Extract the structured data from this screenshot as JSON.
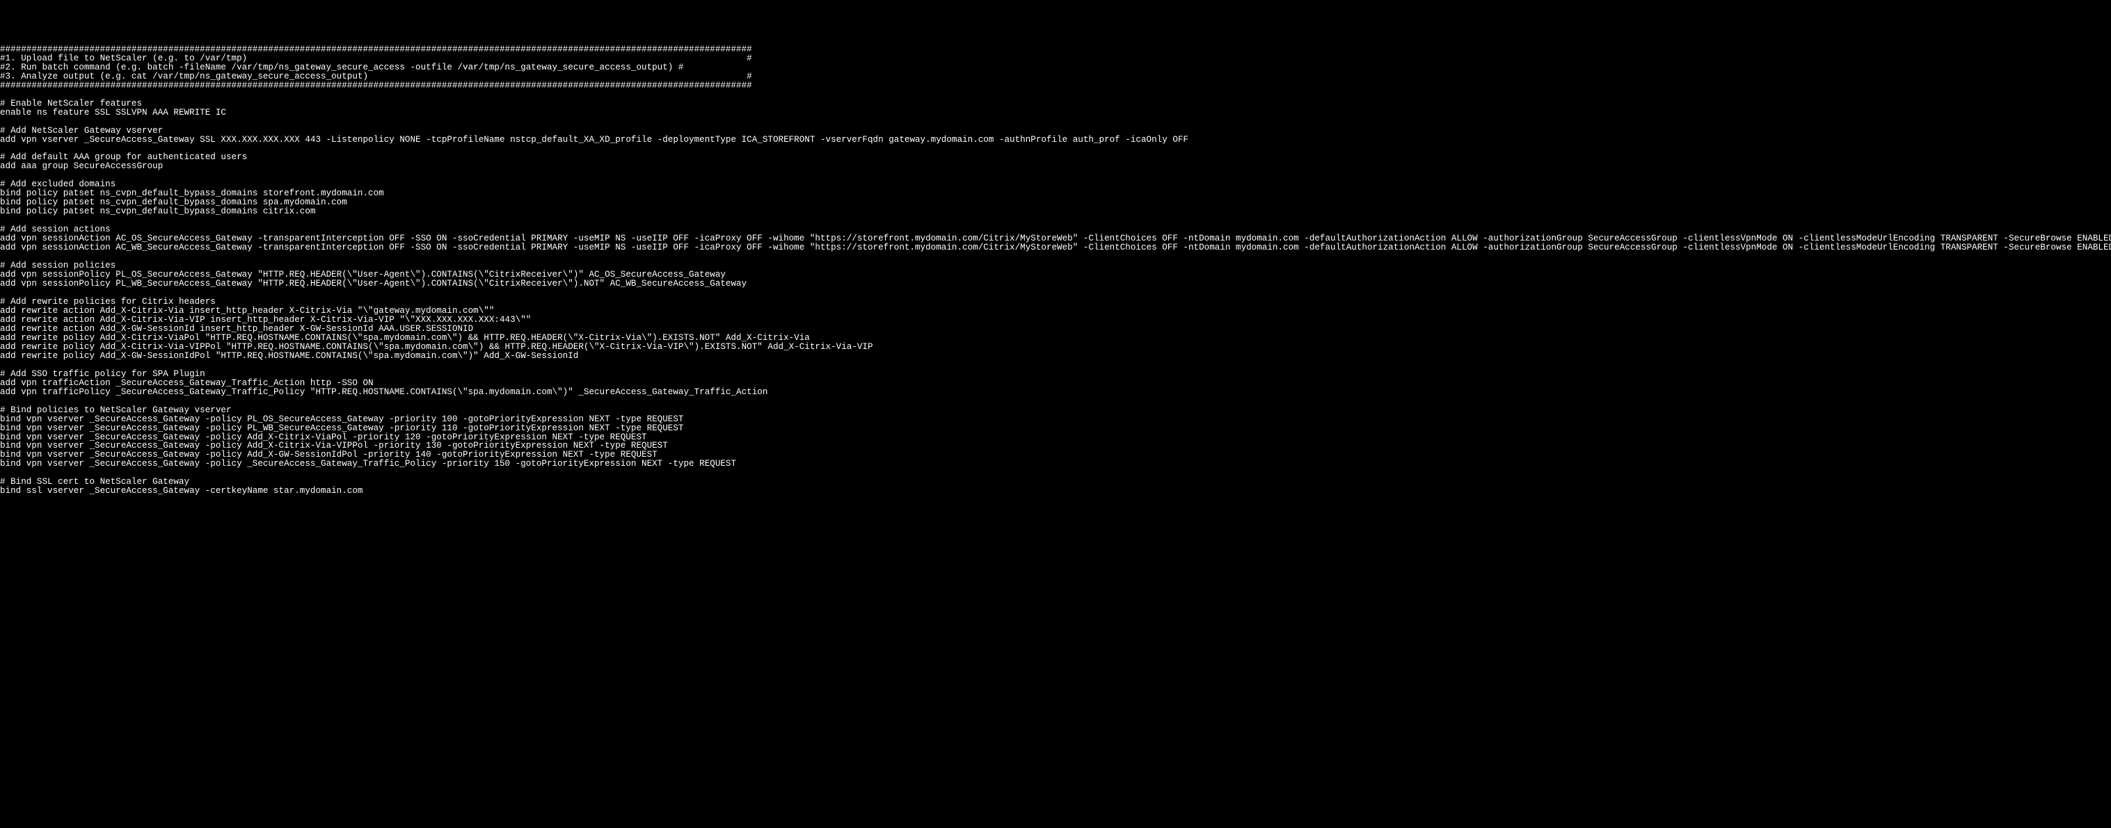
{
  "lines": [
    "###############################################################################################################################################",
    "#1. Upload file to NetScaler (e.g. to /var/tmp)                                                                                               #",
    "#2. Run batch command (e.g. batch -fileName /var/tmp/ns_gateway_secure_access -outfile /var/tmp/ns_gateway_secure_access_output) #",
    "#3. Analyze output (e.g. cat /var/tmp/ns_gateway_secure_access_output)                                                                        #",
    "###############################################################################################################################################",
    "",
    "# Enable NetScaler features",
    "enable ns feature SSL SSLVPN AAA REWRITE IC",
    "",
    "# Add NetScaler Gateway vserver",
    "add vpn vserver _SecureAccess_Gateway SSL XXX.XXX.XXX.XXX 443 -Listenpolicy NONE -tcpProfileName nstcp_default_XA_XD_profile -deploymentType ICA_STOREFRONT -vserverFqdn gateway.mydomain.com -authnProfile auth_prof -icaOnly OFF",
    "",
    "# Add default AAA group for authenticated users",
    "add aaa group SecureAccessGroup",
    "",
    "# Add excluded domains",
    "bind policy patset ns_cvpn_default_bypass_domains storefront.mydomain.com",
    "bind policy patset ns_cvpn_default_bypass_domains spa.mydomain.com",
    "bind policy patset ns_cvpn_default_bypass_domains citrix.com",
    "",
    "# Add session actions",
    "add vpn sessionAction AC_OS_SecureAccess_Gateway -transparentInterception OFF -SSO ON -ssoCredential PRIMARY -useMIP NS -useIIP OFF -icaProxy OFF -wihome \"https://storefront.mydomain.com/Citrix/MyStoreWeb\" -ClientChoices OFF -ntDomain mydomain.com -defaultAuthorizationAction ALLOW -authorizationGroup SecureAccessGroup -clientlessVpnMode ON -clientlessModeUrlEncoding TRANSPARENT -SecureBrowse ENABLED -storefronturl \"https://storefront.mydomain.com\" -sfGatewayAuthType domain",
    "add vpn sessionAction AC_WB_SecureAccess_Gateway -transparentInterception OFF -SSO ON -ssoCredential PRIMARY -useMIP NS -useIIP OFF -icaProxy OFF -wihome \"https://storefront.mydomain.com/Citrix/MyStoreWeb\" -ClientChoices OFF -ntDomain mydomain.com -defaultAuthorizationAction ALLOW -authorizationGroup SecureAccessGroup -clientlessVpnMode ON -clientlessModeUrlEncoding TRANSPARENT -SecureBrowse ENABLED -storefronturl \"https://storefront.mydomain.com\" -sfGatewayAuthType domain",
    "",
    "# Add session policies",
    "add vpn sessionPolicy PL_OS_SecureAccess_Gateway \"HTTP.REQ.HEADER(\\\"User-Agent\\\").CONTAINS(\\\"CitrixReceiver\\\")\" AC_OS_SecureAccess_Gateway",
    "add vpn sessionPolicy PL_WB_SecureAccess_Gateway \"HTTP.REQ.HEADER(\\\"User-Agent\\\").CONTAINS(\\\"CitrixReceiver\\\").NOT\" AC_WB_SecureAccess_Gateway",
    "",
    "# Add rewrite policies for Citrix headers",
    "add rewrite action Add_X-Citrix-Via insert_http_header X-Citrix-Via \"\\\"gateway.mydomain.com\\\"\"",
    "add rewrite action Add_X-Citrix-Via-VIP insert_http_header X-Citrix-Via-VIP \"\\\"XXX.XXX.XXX.XXX:443\\\"\"",
    "add rewrite action Add_X-GW-SessionId insert_http_header X-GW-SessionId AAA.USER.SESSIONID",
    "add rewrite policy Add_X-Citrix-ViaPol \"HTTP.REQ.HOSTNAME.CONTAINS(\\\"spa.mydomain.com\\\") && HTTP.REQ.HEADER(\\\"X-Citrix-Via\\\").EXISTS.NOT\" Add_X-Citrix-Via",
    "add rewrite policy Add_X-Citrix-Via-VIPPol \"HTTP.REQ.HOSTNAME.CONTAINS(\\\"spa.mydomain.com\\\") && HTTP.REQ.HEADER(\\\"X-Citrix-Via-VIP\\\").EXISTS.NOT\" Add_X-Citrix-Via-VIP",
    "add rewrite policy Add_X-GW-SessionIdPol \"HTTP.REQ.HOSTNAME.CONTAINS(\\\"spa.mydomain.com\\\")\" Add_X-GW-SessionId",
    "",
    "# Add SSO traffic policy for SPA Plugin",
    "add vpn trafficAction _SecureAccess_Gateway_Traffic_Action http -SSO ON",
    "add vpn trafficPolicy _SecureAccess_Gateway_Traffic_Policy \"HTTP.REQ.HOSTNAME.CONTAINS(\\\"spa.mydomain.com\\\")\" _SecureAccess_Gateway_Traffic_Action",
    "",
    "# Bind policies to NetScaler Gateway vserver",
    "bind vpn vserver _SecureAccess_Gateway -policy PL_OS_SecureAccess_Gateway -priority 100 -gotoPriorityExpression NEXT -type REQUEST",
    "bind vpn vserver _SecureAccess_Gateway -policy PL_WB_SecureAccess_Gateway -priority 110 -gotoPriorityExpression NEXT -type REQUEST",
    "bind vpn vserver _SecureAccess_Gateway -policy Add_X-Citrix-ViaPol -priority 120 -gotoPriorityExpression NEXT -type REQUEST",
    "bind vpn vserver _SecureAccess_Gateway -policy Add_X-Citrix-Via-VIPPol -priority 130 -gotoPriorityExpression NEXT -type REQUEST",
    "bind vpn vserver _SecureAccess_Gateway -policy Add_X-GW-SessionIdPol -priority 140 -gotoPriorityExpression NEXT -type REQUEST",
    "bind vpn vserver _SecureAccess_Gateway -policy _SecureAccess_Gateway_Traffic_Policy -priority 150 -gotoPriorityExpression NEXT -type REQUEST",
    "",
    "# Bind SSL cert to NetScaler Gateway",
    "bind ssl vserver _SecureAccess_Gateway -certkeyName star.mydomain.com"
  ]
}
